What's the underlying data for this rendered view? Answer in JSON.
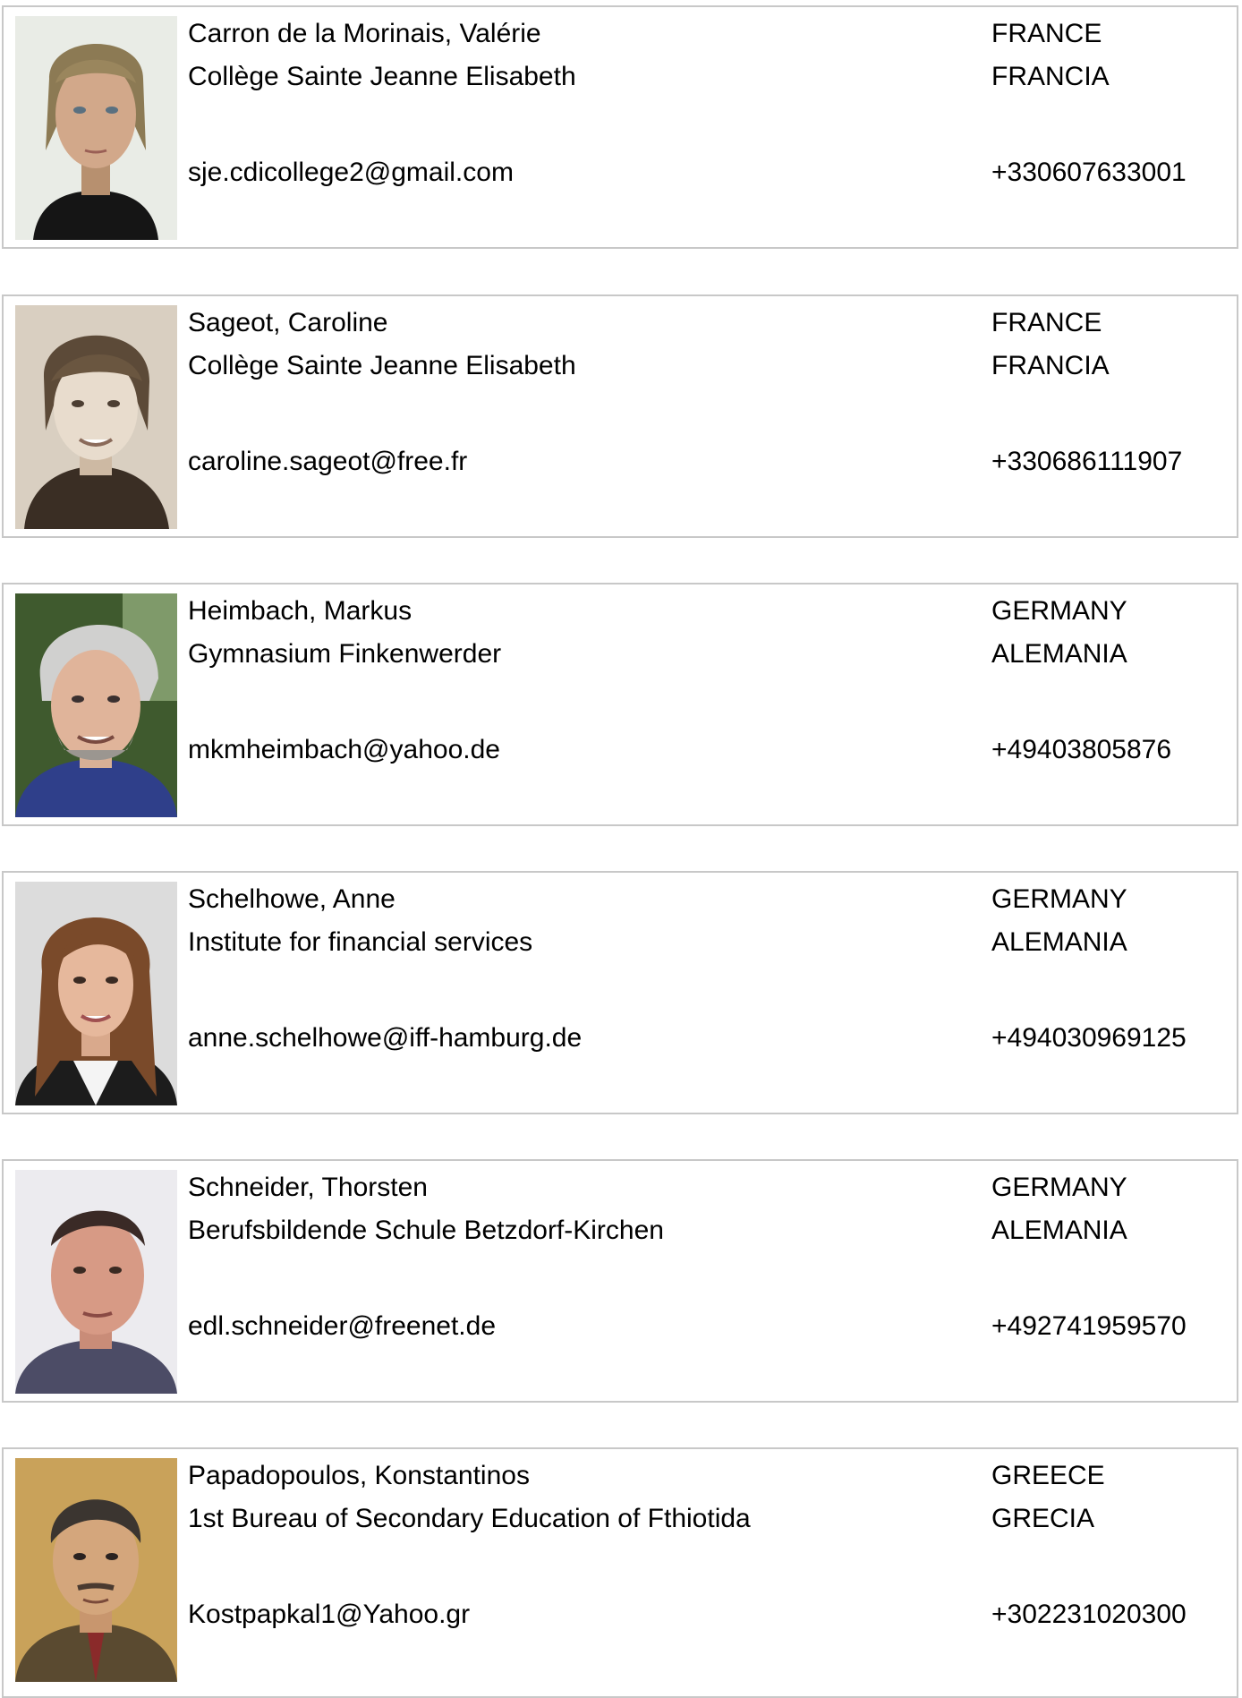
{
  "people": [
    {
      "name": "Carron de la Morinais, Valérie",
      "school": "Collège Sainte Jeanne Elisabeth",
      "email": "sje.cdicollege2@gmail.com",
      "country_en": "FRANCE",
      "country_es": "FRANCIA",
      "phone": "+330607633001"
    },
    {
      "name": "Sageot, Caroline",
      "school": "Collège Sainte Jeanne Elisabeth",
      "email": "caroline.sageot@free.fr",
      "country_en": "FRANCE",
      "country_es": "FRANCIA",
      "phone": "+330686111907"
    },
    {
      "name": "Heimbach, Markus",
      "school": "Gymnasium Finkenwerder",
      "email": "mkmheimbach@yahoo.de",
      "country_en": "GERMANY",
      "country_es": "ALEMANIA",
      "phone": "+49403805876"
    },
    {
      "name": "Schelhowe, Anne",
      "school": "Institute for financial services",
      "email": "anne.schelhowe@iff-hamburg.de",
      "country_en": "GERMANY",
      "country_es": "ALEMANIA",
      "phone": "+494030969125"
    },
    {
      "name": "Schneider, Thorsten",
      "school": "Berufsbildende Schule Betzdorf-Kirchen",
      "email": "edl.schneider@freenet.de",
      "country_en": "GERMANY",
      "country_es": "ALEMANIA",
      "phone": "+492741959570"
    },
    {
      "name": "Papadopoulos, Konstantinos",
      "school": "1st  Bureau of Secondary Education of Fthiotida",
      "email": "Kostpapkal1@Yahoo.gr",
      "country_en": "GREECE",
      "country_es": "GRECIA",
      "phone": "+302231020300"
    }
  ]
}
